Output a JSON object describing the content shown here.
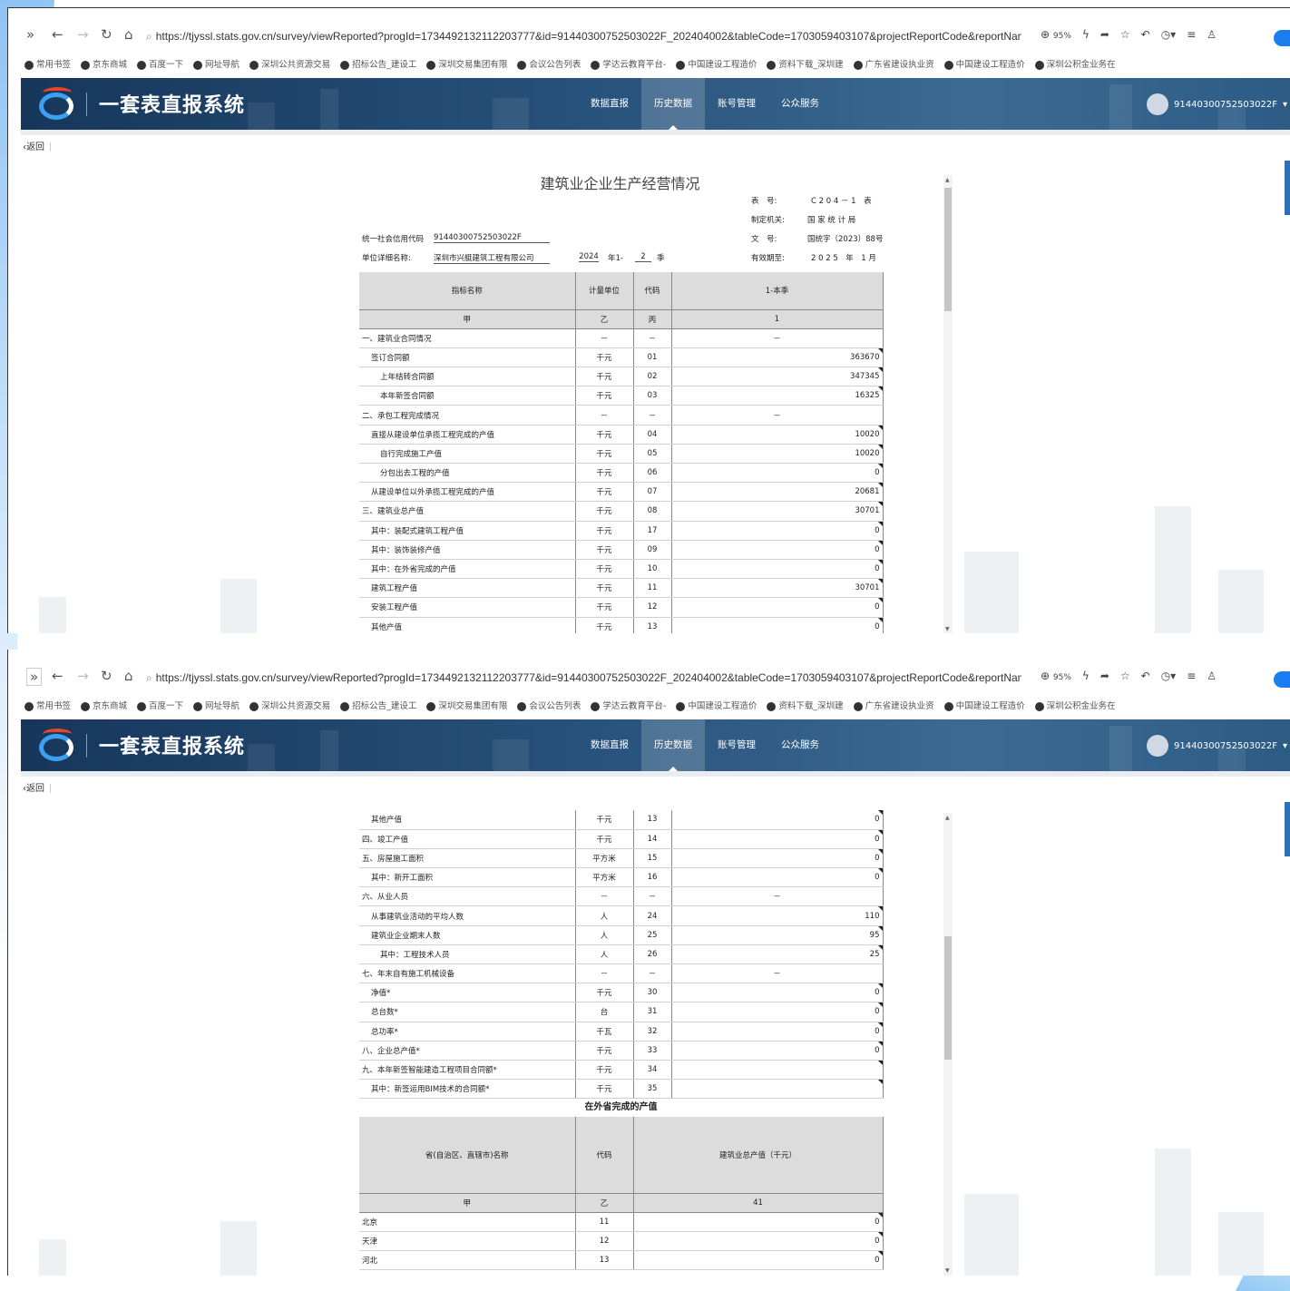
{
  "browser": {
    "url": "https://tjyssl.stats.gov.cn/survey/viewReported?progId=1734492132112203777&id=91440300752503022F_202404002&tableCode=1703059403107&projectReportCode&reportName=建筑业:",
    "zoom": "95%",
    "bookmarks": [
      "常用书签",
      "京东商城",
      "百度一下",
      "网址导航",
      "深圳公共资源交易",
      "招标公告_建设工",
      "深圳交易集团有限",
      "会议公告列表",
      "学达云教育平台-",
      "中国建设工程造价",
      "资料下载_深圳建",
      "广东省建设执业资",
      "中国建设工程造价",
      "深圳公积金业务在"
    ]
  },
  "app": {
    "name": "一套表直报系统",
    "menu": [
      "数据直报",
      "历史数据",
      "账号管理",
      "公众服务"
    ],
    "active_menu": "历史数据",
    "user": "91440300752503022F",
    "back": "返回"
  },
  "form": {
    "title": "建筑业企业生产经营情况",
    "meta": {
      "table_no_label": "表　号:",
      "table_no": "C 2 0 4 － 1　表",
      "org_label": "制定机关:",
      "org": "国 家 统 计 局",
      "doc_label": "文　号:",
      "doc": "国统字（2023）88号",
      "valid_label": "有效期至:",
      "valid": "2 0 2 5　年　1 月",
      "credit_label": "统一社会信用代码",
      "credit": "91440300752503022F",
      "unit_label": "单位详细名称:",
      "unit": "深圳市兴艇建筑工程有限公司",
      "year": "2024",
      "year_suffix": "年1-",
      "quarter": "2",
      "quarter_suffix": "季"
    },
    "headers": [
      "指标名称",
      "计量单位",
      "代码",
      "1-本季"
    ],
    "subheaders": [
      "甲",
      "乙",
      "丙",
      "1"
    ],
    "rows_part1": [
      {
        "name": "一、建筑业合同情况",
        "indent": 0,
        "unit": "－",
        "code": "－",
        "value": "－"
      },
      {
        "name": "签订合同额",
        "indent": 1,
        "unit": "千元",
        "code": "01",
        "value": "363670"
      },
      {
        "name": "上年结转合同额",
        "indent": 2,
        "unit": "千元",
        "code": "02",
        "value": "347345"
      },
      {
        "name": "本年新签合同额",
        "indent": 2,
        "unit": "千元",
        "code": "03",
        "value": "16325"
      },
      {
        "name": "二、承包工程完成情况",
        "indent": 0,
        "unit": "－",
        "code": "－",
        "value": "－"
      },
      {
        "name": "直接从建设单位承揽工程完成的产值",
        "indent": 1,
        "unit": "千元",
        "code": "04",
        "value": "10020"
      },
      {
        "name": "自行完成施工产值",
        "indent": 2,
        "unit": "千元",
        "code": "05",
        "value": "10020"
      },
      {
        "name": "分包出去工程的产值",
        "indent": 2,
        "unit": "千元",
        "code": "06",
        "value": "0"
      },
      {
        "name": "从建设单位以外承揽工程完成的产值",
        "indent": 1,
        "unit": "千元",
        "code": "07",
        "value": "20681"
      },
      {
        "name": "三、建筑业总产值",
        "indent": 0,
        "unit": "千元",
        "code": "08",
        "value": "30701"
      },
      {
        "name": "其中：装配式建筑工程产值",
        "indent": 1,
        "unit": "千元",
        "code": "17",
        "value": "0"
      },
      {
        "name": "其中：装饰装修产值",
        "indent": 1,
        "unit": "千元",
        "code": "09",
        "value": "0"
      },
      {
        "name": "其中：在外省完成的产值",
        "indent": 1,
        "unit": "千元",
        "code": "10",
        "value": "0"
      },
      {
        "name": "建筑工程产值",
        "indent": 1,
        "unit": "千元",
        "code": "11",
        "value": "30701"
      },
      {
        "name": "安装工程产值",
        "indent": 1,
        "unit": "千元",
        "code": "12",
        "value": "0"
      },
      {
        "name": "其他产值",
        "indent": 1,
        "unit": "千元",
        "code": "13",
        "value": "0"
      }
    ],
    "rows_part2": [
      {
        "name": "其他产值",
        "indent": 1,
        "unit": "千元",
        "code": "13",
        "value": "0"
      },
      {
        "name": "四、竣工产值",
        "indent": 0,
        "unit": "千元",
        "code": "14",
        "value": "0"
      },
      {
        "name": "五、房屋施工面积",
        "indent": 0,
        "unit": "平方米",
        "code": "15",
        "value": "0"
      },
      {
        "name": "其中：新开工面积",
        "indent": 1,
        "unit": "平方米",
        "code": "16",
        "value": "0"
      },
      {
        "name": "六、从业人员",
        "indent": 0,
        "unit": "－",
        "code": "－",
        "value": "－"
      },
      {
        "name": "从事建筑业活动的平均人数",
        "indent": 1,
        "unit": "人",
        "code": "24",
        "value": "110"
      },
      {
        "name": "建筑业企业期末人数",
        "indent": 1,
        "unit": "人",
        "code": "25",
        "value": "95"
      },
      {
        "name": "其中：工程技术人员",
        "indent": 2,
        "unit": "人",
        "code": "26",
        "value": "25"
      },
      {
        "name": "七、年末自有施工机械设备",
        "indent": 0,
        "unit": "－",
        "code": "－",
        "value": "－"
      },
      {
        "name": "净值*",
        "indent": 1,
        "unit": "千元",
        "code": "30",
        "value": "0"
      },
      {
        "name": "总台数*",
        "indent": 1,
        "unit": "台",
        "code": "31",
        "value": "0"
      },
      {
        "name": "总功率*",
        "indent": 1,
        "unit": "千瓦",
        "code": "32",
        "value": "0"
      },
      {
        "name": "八、企业总产值*",
        "indent": 0,
        "unit": "千元",
        "code": "33",
        "value": "0"
      },
      {
        "name": "九、本年新签智能建造工程项目合同额*",
        "indent": 0,
        "unit": "千元",
        "code": "34",
        "value": ""
      },
      {
        "name": "其中：新签运用BIM技术的合同额*",
        "indent": 1,
        "unit": "千元",
        "code": "35",
        "value": ""
      }
    ],
    "province_title": "在外省完成的产值",
    "province_headers": [
      "省(自治区、直辖市)名称",
      "代码",
      "建筑业总产值（千元）"
    ],
    "province_subheaders": [
      "甲",
      "乙",
      "41"
    ],
    "province_rows": [
      {
        "name": "北京",
        "code": "11",
        "value": "0"
      },
      {
        "name": "天津",
        "code": "12",
        "value": "0"
      },
      {
        "name": "河北",
        "code": "13",
        "value": "0"
      }
    ]
  }
}
